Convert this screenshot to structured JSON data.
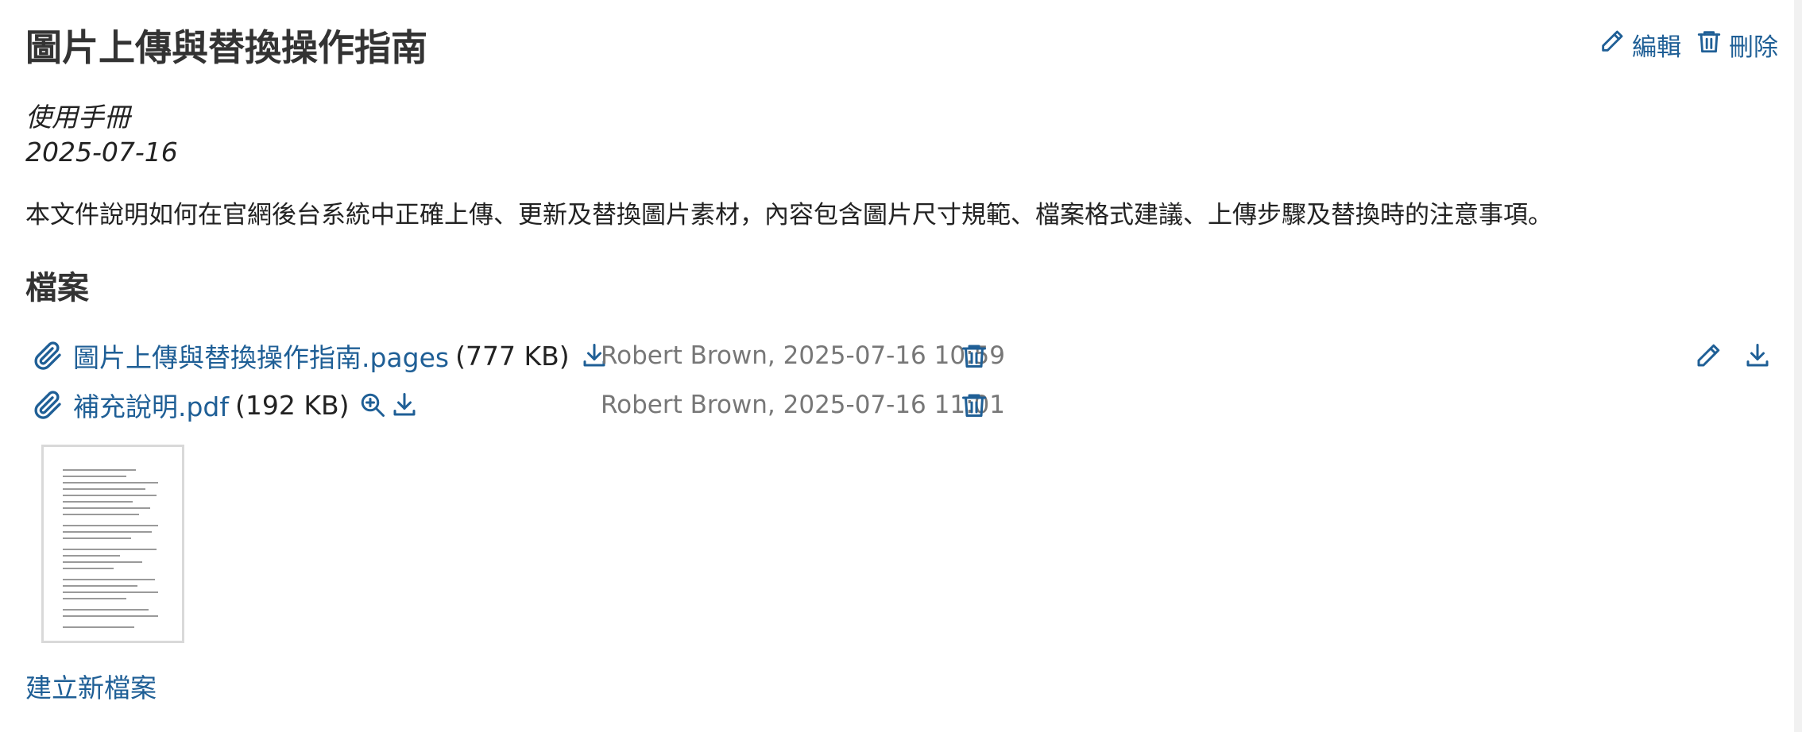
{
  "page": {
    "title": "圖片上傳與替換操作指南",
    "category": "使用手冊",
    "date": "2025-07-16",
    "description": "本文件說明如何在官網後台系統中正確上傳、更新及替換圖片素材，內容包含圖片尺寸規範、檔案格式建議、上傳步驟及替換時的注意事項。"
  },
  "actions": {
    "edit_label": "編輯",
    "delete_label": "刪除"
  },
  "files_section": {
    "heading": "檔案",
    "files": [
      {
        "name": "圖片上傳與替換操作指南.pages",
        "size": "(777 KB)",
        "meta": "Robert Brown, 2025-07-16 10:59",
        "icons": [
          "paperclip-icon",
          "download-icon",
          "trash-icon",
          "pencil-icon",
          "download-icon"
        ]
      },
      {
        "name": "補充說明.pdf",
        "size": "(192 KB)",
        "meta": "Robert Brown, 2025-07-16 11:01",
        "icons": [
          "paperclip-icon",
          "zoom-in-icon",
          "download-icon",
          "trash-icon"
        ]
      }
    ],
    "new_file_label": "建立新檔案"
  },
  "colors": {
    "link": "#1f5f96",
    "text": "#222222",
    "meta": "#777777",
    "heading": "#333333"
  }
}
